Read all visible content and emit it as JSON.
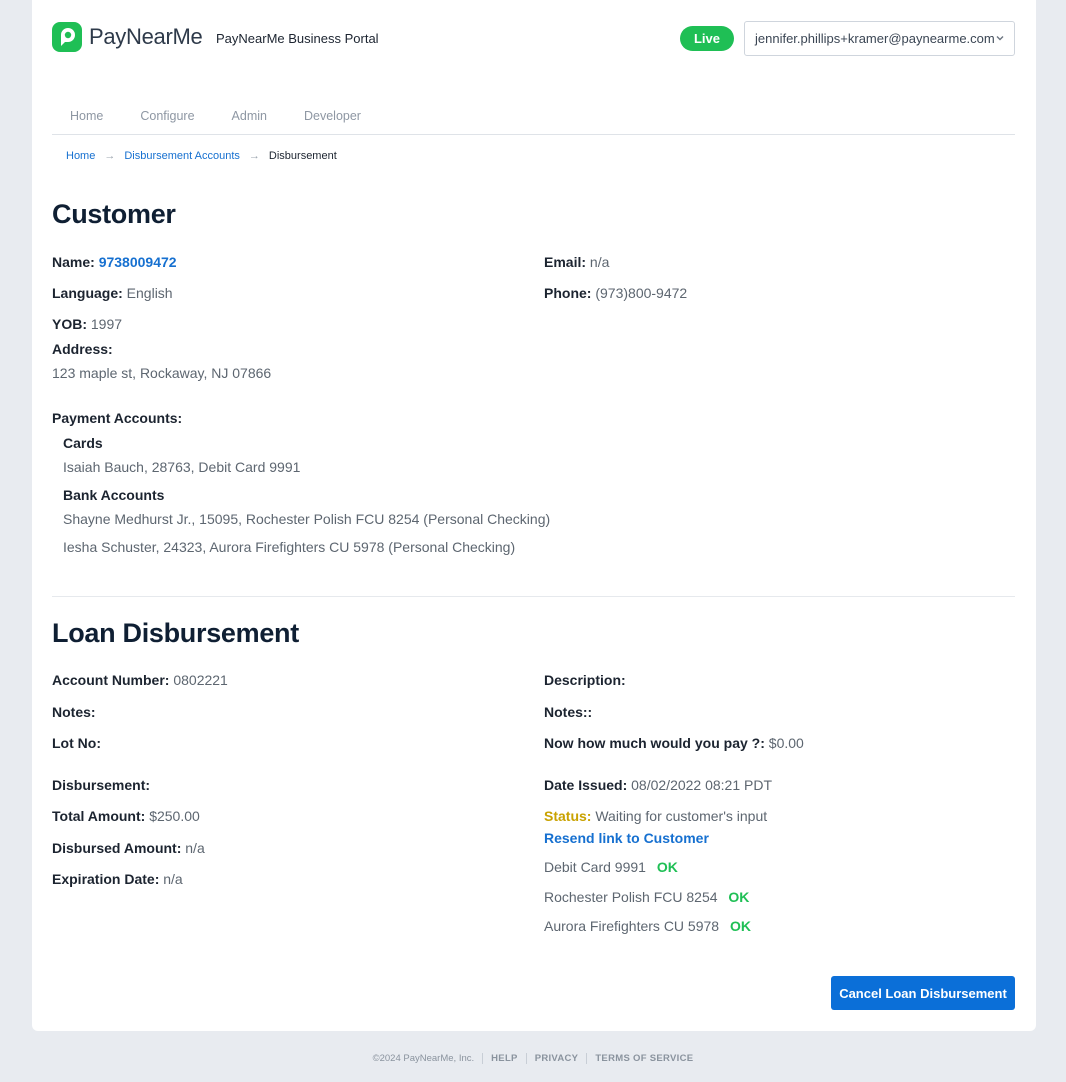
{
  "header": {
    "logo_text": "PayNearMe",
    "portal_title": "PayNearMe Business Portal",
    "live_badge": "Live",
    "account_email": "jennifer.phillips+kramer@paynearme.com",
    "brand_color": "#1fbf55"
  },
  "nav": {
    "items": [
      "Home",
      "Configure",
      "Admin",
      "Developer"
    ]
  },
  "breadcrumb": {
    "home": "Home",
    "accounts": "Disbursement Accounts",
    "current": "Disbursement",
    "separator": "→"
  },
  "customer": {
    "heading": "Customer",
    "name_label": "Name:",
    "name_value": "9738009472",
    "email_label": "Email:",
    "email_value": "n/a",
    "language_label": "Language:",
    "language_value": "English",
    "phone_label": "Phone:",
    "phone_value": "(973)800-9472",
    "yob_label": "YOB:",
    "yob_value": "1997",
    "address_label": "Address:",
    "address_value": "123 maple st,  Rockaway, NJ 07866",
    "payment_accounts_label": "Payment Accounts:",
    "cards_label": "Cards",
    "cards": [
      "Isaiah Bauch, 28763, Debit Card 9991"
    ],
    "bank_accounts_label": "Bank Accounts",
    "bank_accounts": [
      "Shayne Medhurst Jr., 15095, Rochester Polish FCU 8254 (Personal Checking)",
      "Iesha Schuster, 24323, Aurora Firefighters CU 5978 (Personal Checking)"
    ]
  },
  "loan": {
    "heading": "Loan Disbursement",
    "account_number_label": "Account Number:",
    "account_number_value": "0802221",
    "description_label": "Description:",
    "notes_label": "Notes:",
    "notes2_label": "Notes::",
    "lot_label": "Lot No:",
    "pay_label": "Now how much would you pay ?:",
    "pay_value": "$0.00",
    "disbursement_label": "Disbursement:",
    "date_issued_label": "Date Issued:",
    "date_issued_value": "08/02/2022 08:21 PDT",
    "total_amount_label": "Total Amount:",
    "total_amount_value": "$250.00",
    "status_label": "Status:",
    "status_value": "Waiting for customer's input",
    "resend_link": "Resend link to Customer",
    "disbursed_amount_label": "Disbursed Amount:",
    "disbursed_amount_value": "n/a",
    "expiration_label": "Expiration Date:",
    "expiration_value": "n/a",
    "methods": [
      {
        "name": "Debit Card 9991",
        "status": "OK"
      },
      {
        "name": "Rochester Polish FCU 8254",
        "status": "OK"
      },
      {
        "name": "Aurora Firefighters CU 5978",
        "status": "OK"
      }
    ],
    "cancel_button": "Cancel Loan Disbursement"
  },
  "footer": {
    "copyright": "©2024 PayNearMe, Inc.",
    "help": "HELP",
    "privacy": "PRIVACY",
    "terms": "TERMS OF SERVICE"
  }
}
